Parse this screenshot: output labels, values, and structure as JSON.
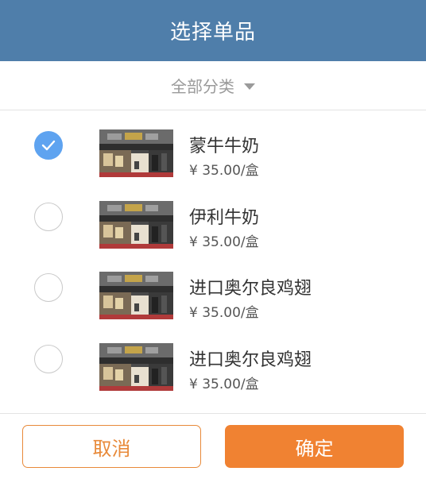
{
  "header": {
    "title": "选择单品"
  },
  "filter": {
    "label": "全部分类",
    "icon": "caret-down-icon"
  },
  "items": [
    {
      "name": "蒙牛牛奶",
      "price": "¥ 35.00/盒",
      "checked": true
    },
    {
      "name": "伊利牛奶",
      "price": "¥ 35.00/盒",
      "checked": false
    },
    {
      "name": "进口奥尔良鸡翅",
      "price": "¥ 35.00/盒",
      "checked": false
    },
    {
      "name": "进口奥尔良鸡翅",
      "price": "¥ 35.00/盒",
      "checked": false
    }
  ],
  "footer": {
    "cancel_label": "取消",
    "confirm_label": "确定"
  },
  "colors": {
    "header_bg": "#4f7eaa",
    "check_on": "#5ea3f0",
    "accent": "#f08232"
  }
}
